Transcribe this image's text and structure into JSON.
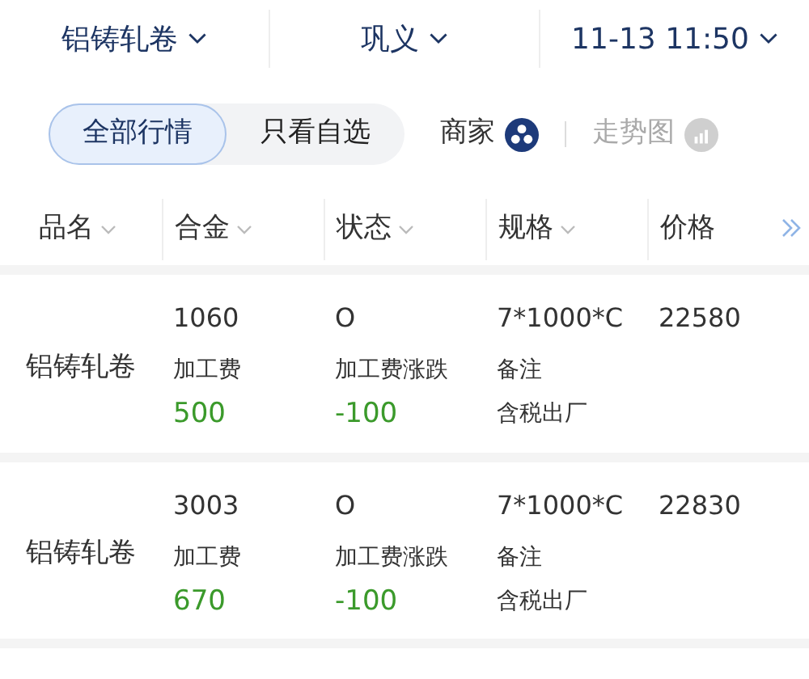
{
  "top_bar": [
    {
      "label": "铝铸轧卷"
    },
    {
      "label": "巩义"
    },
    {
      "label": "11-13 11:50"
    }
  ],
  "view_toggle": [
    {
      "label": "全部行情",
      "selected": true
    },
    {
      "label": "只看自选",
      "selected": false
    }
  ],
  "merchant": {
    "label": "商家"
  },
  "trend": {
    "label": "走势图",
    "disabled": true
  },
  "table": {
    "columns": [
      {
        "label": "品名",
        "sortable": true
      },
      {
        "label": "合金",
        "sortable": true
      },
      {
        "label": "状态",
        "sortable": true
      },
      {
        "label": "规格",
        "sortable": true
      },
      {
        "label": "价格",
        "sortable": false
      }
    ],
    "rows": [
      {
        "name": "铝铸轧卷",
        "alloy": "1060",
        "temper": "O",
        "spec": "7*1000*C",
        "price": "22580",
        "fee_label": "加工费",
        "fee": "500",
        "change_label": "加工费涨跌",
        "change": "-100",
        "note_label": "备注",
        "note": "含税出厂"
      },
      {
        "name": "铝铸轧卷",
        "alloy": "3003",
        "temper": "O",
        "spec": "7*1000*C",
        "price": "22830",
        "fee_label": "加工费",
        "fee": "670",
        "change_label": "加工费涨跌",
        "change": "-100",
        "note_label": "备注",
        "note": "含税出厂"
      }
    ]
  }
}
